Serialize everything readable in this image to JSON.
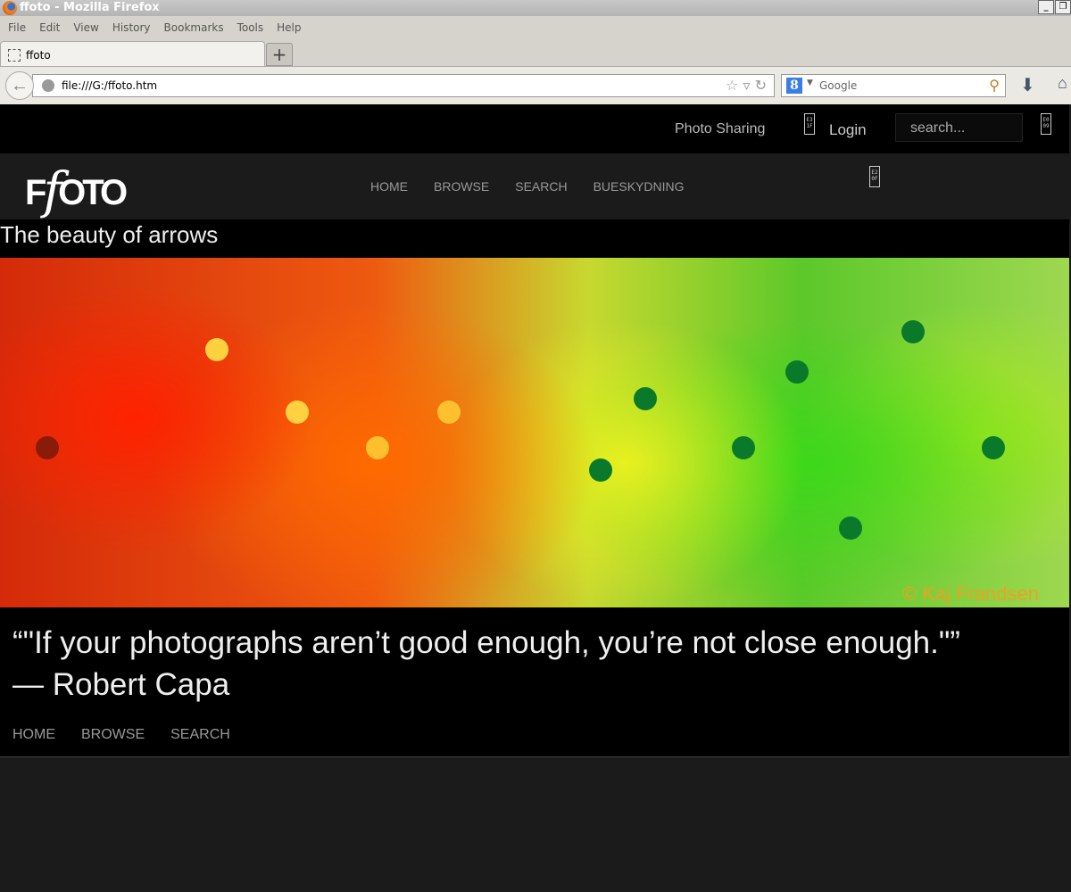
{
  "window": {
    "title": "ffoto - Mozilla Firefox"
  },
  "menu": [
    "File",
    "Edit",
    "View",
    "History",
    "Bookmarks",
    "Tools",
    "Help"
  ],
  "tab": {
    "label": "ffoto",
    "new_tab": "+"
  },
  "url": "file:///G:/ffoto.htm",
  "search_engine": {
    "placeholder": "Google",
    "badge": "8"
  },
  "site": {
    "top": {
      "photo_sharing": "Photo Sharing",
      "login": "Login",
      "search_placeholder": "search...",
      "glyph1": "E3 1F",
      "glyph2": "E0 09",
      "glyph3": "E2 0F"
    },
    "logo": "FFOTO",
    "nav": [
      "HOME",
      "BROWSE",
      "SEARCH",
      "BUESKYDNING"
    ],
    "subtitle": "The beauty of arrows",
    "credit": "© Kaj Frandsen",
    "quote": "“\"If your photographs aren’t good enough, you’re not close enough.\"”",
    "author": "— Robert Capa",
    "footer_nav": [
      "HOME",
      "BROWSE",
      "SEARCH"
    ]
  },
  "colors": {
    "accent_credit": "#f0a020",
    "page_bg": "#000000",
    "header_bg": "#1b1b1b"
  }
}
